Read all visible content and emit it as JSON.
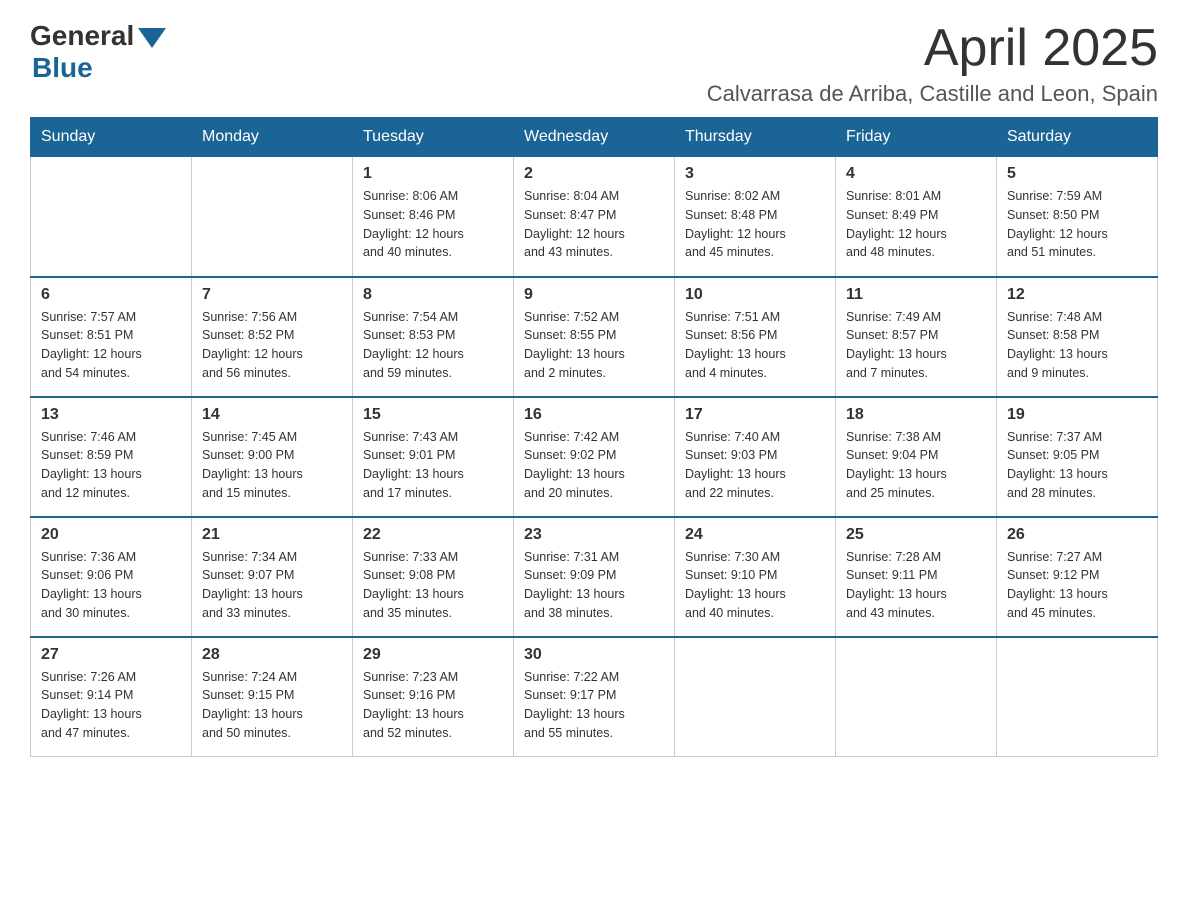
{
  "logo": {
    "general": "General",
    "blue": "Blue"
  },
  "title": "April 2025",
  "location": "Calvarrasa de Arriba, Castille and Leon, Spain",
  "headers": [
    "Sunday",
    "Monday",
    "Tuesday",
    "Wednesday",
    "Thursday",
    "Friday",
    "Saturday"
  ],
  "weeks": [
    [
      {
        "day": "",
        "info": ""
      },
      {
        "day": "",
        "info": ""
      },
      {
        "day": "1",
        "info": "Sunrise: 8:06 AM\nSunset: 8:46 PM\nDaylight: 12 hours\nand 40 minutes."
      },
      {
        "day": "2",
        "info": "Sunrise: 8:04 AM\nSunset: 8:47 PM\nDaylight: 12 hours\nand 43 minutes."
      },
      {
        "day": "3",
        "info": "Sunrise: 8:02 AM\nSunset: 8:48 PM\nDaylight: 12 hours\nand 45 minutes."
      },
      {
        "day": "4",
        "info": "Sunrise: 8:01 AM\nSunset: 8:49 PM\nDaylight: 12 hours\nand 48 minutes."
      },
      {
        "day": "5",
        "info": "Sunrise: 7:59 AM\nSunset: 8:50 PM\nDaylight: 12 hours\nand 51 minutes."
      }
    ],
    [
      {
        "day": "6",
        "info": "Sunrise: 7:57 AM\nSunset: 8:51 PM\nDaylight: 12 hours\nand 54 minutes."
      },
      {
        "day": "7",
        "info": "Sunrise: 7:56 AM\nSunset: 8:52 PM\nDaylight: 12 hours\nand 56 minutes."
      },
      {
        "day": "8",
        "info": "Sunrise: 7:54 AM\nSunset: 8:53 PM\nDaylight: 12 hours\nand 59 minutes."
      },
      {
        "day": "9",
        "info": "Sunrise: 7:52 AM\nSunset: 8:55 PM\nDaylight: 13 hours\nand 2 minutes."
      },
      {
        "day": "10",
        "info": "Sunrise: 7:51 AM\nSunset: 8:56 PM\nDaylight: 13 hours\nand 4 minutes."
      },
      {
        "day": "11",
        "info": "Sunrise: 7:49 AM\nSunset: 8:57 PM\nDaylight: 13 hours\nand 7 minutes."
      },
      {
        "day": "12",
        "info": "Sunrise: 7:48 AM\nSunset: 8:58 PM\nDaylight: 13 hours\nand 9 minutes."
      }
    ],
    [
      {
        "day": "13",
        "info": "Sunrise: 7:46 AM\nSunset: 8:59 PM\nDaylight: 13 hours\nand 12 minutes."
      },
      {
        "day": "14",
        "info": "Sunrise: 7:45 AM\nSunset: 9:00 PM\nDaylight: 13 hours\nand 15 minutes."
      },
      {
        "day": "15",
        "info": "Sunrise: 7:43 AM\nSunset: 9:01 PM\nDaylight: 13 hours\nand 17 minutes."
      },
      {
        "day": "16",
        "info": "Sunrise: 7:42 AM\nSunset: 9:02 PM\nDaylight: 13 hours\nand 20 minutes."
      },
      {
        "day": "17",
        "info": "Sunrise: 7:40 AM\nSunset: 9:03 PM\nDaylight: 13 hours\nand 22 minutes."
      },
      {
        "day": "18",
        "info": "Sunrise: 7:38 AM\nSunset: 9:04 PM\nDaylight: 13 hours\nand 25 minutes."
      },
      {
        "day": "19",
        "info": "Sunrise: 7:37 AM\nSunset: 9:05 PM\nDaylight: 13 hours\nand 28 minutes."
      }
    ],
    [
      {
        "day": "20",
        "info": "Sunrise: 7:36 AM\nSunset: 9:06 PM\nDaylight: 13 hours\nand 30 minutes."
      },
      {
        "day": "21",
        "info": "Sunrise: 7:34 AM\nSunset: 9:07 PM\nDaylight: 13 hours\nand 33 minutes."
      },
      {
        "day": "22",
        "info": "Sunrise: 7:33 AM\nSunset: 9:08 PM\nDaylight: 13 hours\nand 35 minutes."
      },
      {
        "day": "23",
        "info": "Sunrise: 7:31 AM\nSunset: 9:09 PM\nDaylight: 13 hours\nand 38 minutes."
      },
      {
        "day": "24",
        "info": "Sunrise: 7:30 AM\nSunset: 9:10 PM\nDaylight: 13 hours\nand 40 minutes."
      },
      {
        "day": "25",
        "info": "Sunrise: 7:28 AM\nSunset: 9:11 PM\nDaylight: 13 hours\nand 43 minutes."
      },
      {
        "day": "26",
        "info": "Sunrise: 7:27 AM\nSunset: 9:12 PM\nDaylight: 13 hours\nand 45 minutes."
      }
    ],
    [
      {
        "day": "27",
        "info": "Sunrise: 7:26 AM\nSunset: 9:14 PM\nDaylight: 13 hours\nand 47 minutes."
      },
      {
        "day": "28",
        "info": "Sunrise: 7:24 AM\nSunset: 9:15 PM\nDaylight: 13 hours\nand 50 minutes."
      },
      {
        "day": "29",
        "info": "Sunrise: 7:23 AM\nSunset: 9:16 PM\nDaylight: 13 hours\nand 52 minutes."
      },
      {
        "day": "30",
        "info": "Sunrise: 7:22 AM\nSunset: 9:17 PM\nDaylight: 13 hours\nand 55 minutes."
      },
      {
        "day": "",
        "info": ""
      },
      {
        "day": "",
        "info": ""
      },
      {
        "day": "",
        "info": ""
      }
    ]
  ]
}
